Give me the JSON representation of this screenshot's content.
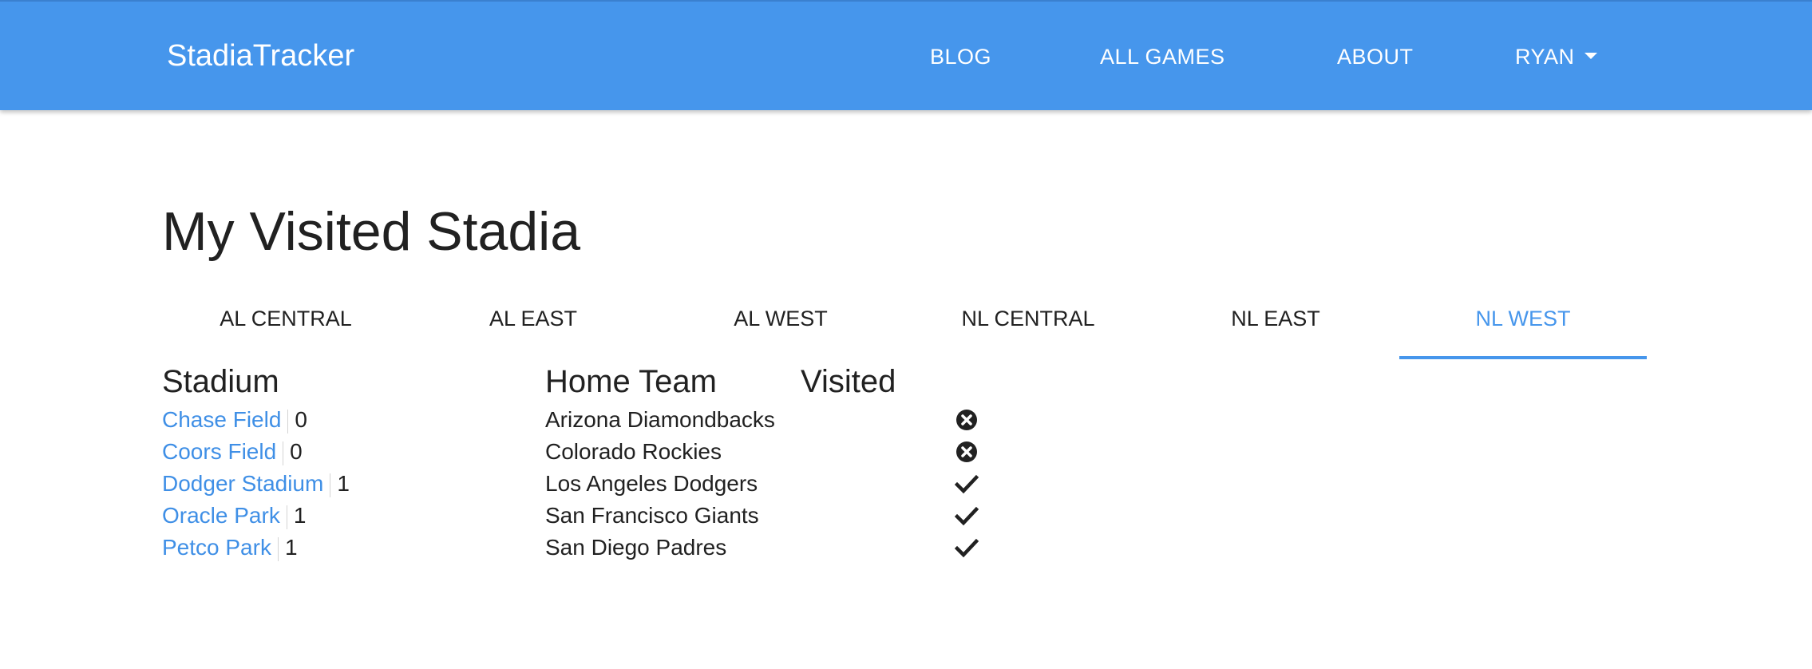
{
  "app": {
    "brand": "StadiaTracker"
  },
  "nav": {
    "blog": "BLOG",
    "all_games": "ALL GAMES",
    "about": "ABOUT",
    "user": "RYAN"
  },
  "page": {
    "title": "My Visited Stadia"
  },
  "tabs": [
    {
      "label": "AL CENTRAL",
      "active": false
    },
    {
      "label": "AL EAST",
      "active": false
    },
    {
      "label": "AL WEST",
      "active": false
    },
    {
      "label": "NL CENTRAL",
      "active": false
    },
    {
      "label": "NL EAST",
      "active": false
    },
    {
      "label": "NL WEST",
      "active": true
    }
  ],
  "table": {
    "headers": {
      "stadium": "Stadium",
      "home_team": "Home Team",
      "visited": "Visited"
    },
    "rows": [
      {
        "stadium": "Chase Field",
        "count": "0",
        "team": "Arizona Diamondbacks",
        "visited": false,
        "icon": "x-circle-icon"
      },
      {
        "stadium": "Coors Field",
        "count": "0",
        "team": "Colorado Rockies",
        "visited": false,
        "icon": "x-circle-icon"
      },
      {
        "stadium": "Dodger Stadium",
        "count": "1",
        "team": "Los Angeles Dodgers",
        "visited": true,
        "icon": "check-icon"
      },
      {
        "stadium": "Oracle Park",
        "count": "1",
        "team": "San Francisco Giants",
        "visited": true,
        "icon": "check-icon"
      },
      {
        "stadium": "Petco Park",
        "count": "1",
        "team": "San Diego Padres",
        "visited": true,
        "icon": "check-icon"
      }
    ]
  },
  "colors": {
    "navbar": "#4696ec",
    "accent": "#4696ec",
    "link": "#3f8fe6"
  }
}
